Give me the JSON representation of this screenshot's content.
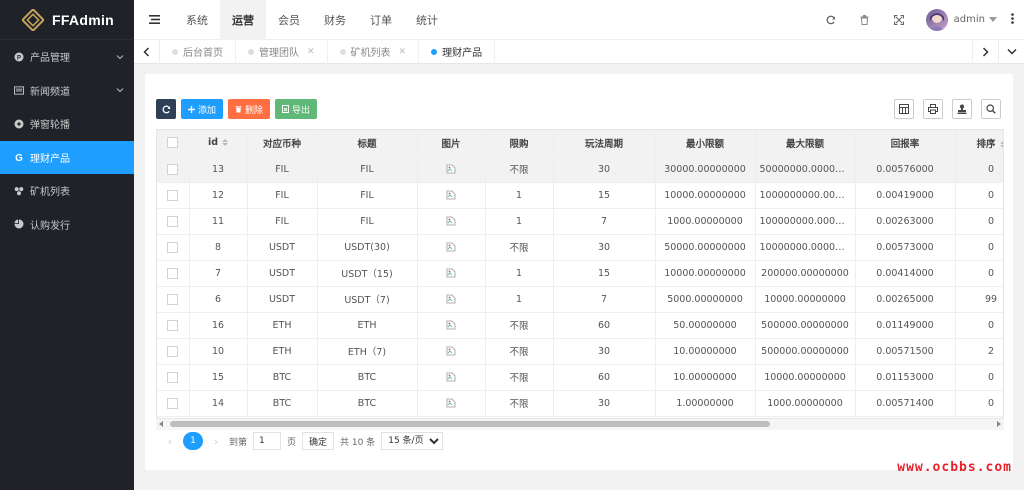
{
  "app": {
    "brand": "FFAdmin"
  },
  "sidebar": {
    "items": [
      {
        "label": "产品管理",
        "icon": "product-icon",
        "has_children": true
      },
      {
        "label": "新闻频道",
        "icon": "news-icon",
        "has_children": true
      },
      {
        "label": "弹窗轮播",
        "icon": "carousel-icon",
        "has_children": false
      },
      {
        "label": "理财产品",
        "icon": "finance-icon",
        "has_children": false,
        "active": true
      },
      {
        "label": "矿机列表",
        "icon": "miner-icon",
        "has_children": false
      },
      {
        "label": "认购发行",
        "icon": "subscribe-icon",
        "has_children": false
      }
    ]
  },
  "header": {
    "menu": [
      "系统",
      "运营",
      "会员",
      "财务",
      "订单",
      "统计"
    ],
    "active_menu": "运营",
    "user": "admin"
  },
  "tabs": [
    {
      "label": "后台首页",
      "closable": false
    },
    {
      "label": "管理团队",
      "closable": true
    },
    {
      "label": "矿机列表",
      "closable": true
    },
    {
      "label": "理财产品",
      "closable": false,
      "active": true
    }
  ],
  "toolbar": {
    "add_label": "添加",
    "delete_label": "删除",
    "export_label": "导出"
  },
  "table": {
    "columns": [
      "id",
      "对应币种",
      "标题",
      "图片",
      "限购",
      "玩法周期",
      "最小限额",
      "最大限额",
      "回报率",
      "排序"
    ],
    "rows": [
      [
        "13",
        "FIL",
        "FIL",
        "",
        "不限",
        "30",
        "30000.00000000",
        "50000000.00000000",
        "0.00576000",
        "0"
      ],
      [
        "12",
        "FIL",
        "FIL",
        "",
        "1",
        "15",
        "10000.00000000",
        "1000000000.00000000",
        "0.00419000",
        "0"
      ],
      [
        "11",
        "FIL",
        "FIL",
        "",
        "1",
        "7",
        "1000.00000000",
        "100000000.00000000",
        "0.00263000",
        "0"
      ],
      [
        "8",
        "USDT",
        "USDT(30)",
        "",
        "不限",
        "30",
        "50000.00000000",
        "10000000.00000000",
        "0.00573000",
        "0"
      ],
      [
        "7",
        "USDT",
        "USDT（15)",
        "",
        "1",
        "15",
        "10000.00000000",
        "200000.00000000",
        "0.00414000",
        "0"
      ],
      [
        "6",
        "USDT",
        "USDT（7)",
        "",
        "1",
        "7",
        "5000.00000000",
        "10000.00000000",
        "0.00265000",
        "99"
      ],
      [
        "16",
        "ETH",
        "ETH",
        "",
        "不限",
        "60",
        "50.00000000",
        "500000.00000000",
        "0.01149000",
        "0"
      ],
      [
        "10",
        "ETH",
        "ETH（7)",
        "",
        "不限",
        "30",
        "10.00000000",
        "500000.00000000",
        "0.00571500",
        "2"
      ],
      [
        "15",
        "BTC",
        "BTC",
        "",
        "不限",
        "60",
        "10.00000000",
        "10000.00000000",
        "0.01153000",
        "0"
      ],
      [
        "14",
        "BTC",
        "BTC",
        "",
        "不限",
        "30",
        "1.00000000",
        "1000.00000000",
        "0.00571400",
        "0"
      ]
    ]
  },
  "pager": {
    "current": "1",
    "goto_label": "到第",
    "goto_value": "1",
    "page_unit": "页",
    "confirm_label": "确定",
    "total_label": "共 10 条",
    "page_size": "15 条/页"
  },
  "watermark": "www.ocbbs.com",
  "colors": {
    "accent": "#1e9fff",
    "sidebar": "#20222a",
    "delete": "#ff5722",
    "export": "#5fb878",
    "refresh": "#2f4056"
  }
}
